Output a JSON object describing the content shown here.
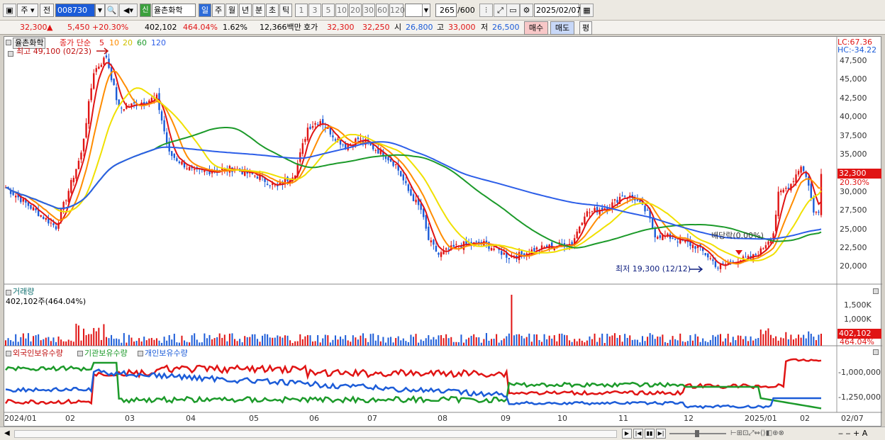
{
  "toolbar": {
    "f1": "주",
    "f2": "전",
    "code": "008730",
    "stock_name": "율촌화학",
    "tabs": [
      "일",
      "주",
      "월",
      "년",
      "분",
      "초",
      "틱"
    ],
    "nums": [
      "1",
      "3",
      "5",
      "10",
      "20",
      "30",
      "60",
      "120"
    ],
    "count": "265",
    "count_total": "/600",
    "date": "2025/02/07",
    "tag": "신"
  },
  "info": {
    "price": "32,300",
    "arrow": "▲",
    "change": "5,450",
    "pct": "+20.30%",
    "volume": "402,102",
    "vol_ratio": "464.04%",
    "turnover": "1.62%",
    "amount": "12,366백만",
    "hoga_label": "호가",
    "ask": "32,300",
    "bid": "32,250",
    "open_label": "시",
    "open": "26,800",
    "high_label": "고",
    "high": "33,000",
    "low_label": "저",
    "low": "26,500",
    "buy": "매수",
    "sell": "매도",
    "avg": "평"
  },
  "price_panel": {
    "name": "율촌화학",
    "ma_label": "종가 단순",
    "ma_periods": [
      "5",
      "10",
      "20",
      "60",
      "120"
    ],
    "max_label": "최고 49,100 (02/23)",
    "min_label": "최저 19,300 (12/12)",
    "event_label": "배당락(0.00%)",
    "lc": "LC:67.36",
    "hc": "HC:-34.22",
    "last_price": "32,300",
    "last_pct": "20.30%",
    "yticks": [
      "47,500",
      "45,000",
      "42,500",
      "40,000",
      "37,500",
      "35,000",
      "32,500",
      "30,000",
      "27,500",
      "25,000",
      "22,500",
      "20,000"
    ]
  },
  "volume_panel": {
    "title": "거래량",
    "value": "402,102주(464.04%)",
    "yticks": [
      "1,500K",
      "1,000K",
      "500K"
    ],
    "last_vol": "402,102",
    "last_pct": "464.04%"
  },
  "holding_panel": {
    "s1": "외국인보유수량",
    "s2": "기관보유수량",
    "s3": "개인보유수량",
    "yticks": [
      "-1,000,000",
      "-1,250,000"
    ]
  },
  "xaxis": [
    "2024/01",
    "02",
    "03",
    "04",
    "05",
    "06",
    "07",
    "08",
    "09",
    "10",
    "11",
    "12",
    "2025/01",
    "02",
    "02/07"
  ],
  "colors": {
    "up": "#e01414",
    "down": "#1c5cd8",
    "ma5": "#e01414",
    "ma10": "#ff8c00",
    "ma20": "#f0e000",
    "ma60": "#1c9a2a",
    "ma120": "#2c5ee8"
  },
  "chart_data": {
    "type": "candlestick",
    "ticker": "008730",
    "name": "율촌화학",
    "period": "daily",
    "range": [
      "2024/01",
      "2025/02/07"
    ],
    "anchors_close": [
      [
        0,
        30500
      ],
      [
        20,
        25200
      ],
      [
        30,
        35000
      ],
      [
        35,
        46000
      ],
      [
        40,
        48000
      ],
      [
        45,
        41000
      ],
      [
        55,
        42000
      ],
      [
        60,
        42500
      ],
      [
        65,
        35000
      ],
      [
        75,
        32500
      ],
      [
        90,
        33000
      ],
      [
        100,
        32000
      ],
      [
        108,
        30500
      ],
      [
        115,
        32500
      ],
      [
        120,
        38500
      ],
      [
        125,
        39500
      ],
      [
        130,
        37500
      ],
      [
        135,
        36000
      ],
      [
        140,
        37000
      ],
      [
        145,
        36000
      ],
      [
        150,
        35000
      ],
      [
        155,
        33500
      ],
      [
        160,
        30000
      ],
      [
        165,
        27500
      ],
      [
        168,
        23500
      ],
      [
        172,
        21500
      ],
      [
        180,
        22800
      ],
      [
        190,
        23000
      ],
      [
        195,
        22200
      ],
      [
        200,
        21200
      ],
      [
        205,
        21500
      ],
      [
        210,
        22200
      ],
      [
        220,
        22800
      ],
      [
        225,
        23000
      ],
      [
        230,
        27000
      ],
      [
        235,
        27500
      ],
      [
        240,
        28000
      ],
      [
        245,
        29500
      ],
      [
        250,
        29000
      ],
      [
        255,
        27000
      ],
      [
        258,
        24200
      ],
      [
        265,
        23800
      ],
      [
        275,
        22500
      ],
      [
        280,
        21000
      ],
      [
        283,
        19800
      ],
      [
        290,
        20800
      ],
      [
        296,
        21000
      ],
      [
        300,
        22000
      ],
      [
        305,
        24500
      ],
      [
        307,
        29500
      ],
      [
        312,
        31000
      ],
      [
        316,
        33500
      ],
      [
        319,
        31000
      ],
      [
        321,
        27000
      ],
      [
        323,
        27500
      ],
      [
        324,
        32300
      ]
    ],
    "last": {
      "open": 26800,
      "high": 33000,
      "low": 26500,
      "close": 32300,
      "change": 5450,
      "pct": 20.3,
      "volume": 402102,
      "vol_pct": 464.04
    },
    "ma": [
      5,
      10,
      20,
      60,
      120
    ],
    "max": {
      "value": 49100,
      "date": "02/23"
    },
    "min": {
      "value": 19300,
      "date": "12/12"
    }
  }
}
